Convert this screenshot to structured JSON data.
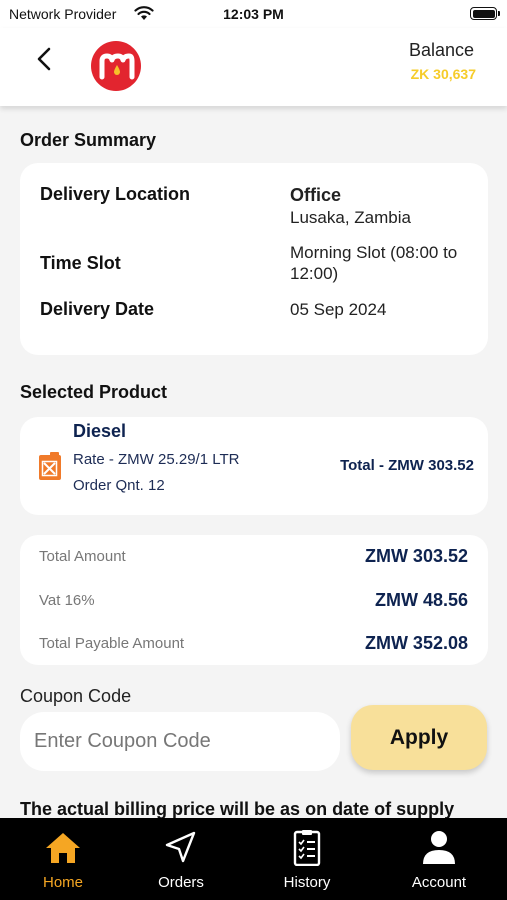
{
  "status_bar": {
    "carrier": "Network Provider",
    "time": "12:03 PM"
  },
  "header": {
    "balance_label": "Balance",
    "balance_value": "ZK 30,637",
    "logo_letter": "m",
    "brand_color": "#e2252f",
    "balance_color": "#f6cc2a"
  },
  "order_summary": {
    "title": "Order Summary",
    "delivery_location_label": "Delivery Location",
    "delivery_location_name": "Office",
    "delivery_location_city": "Lusaka, Zambia",
    "time_slot_label": "Time Slot",
    "time_slot_value": "Morning Slot (08:00 to 12:00)",
    "delivery_date_label": "Delivery Date",
    "delivery_date_value": "05 Sep 2024"
  },
  "selected_product": {
    "title": "Selected Product",
    "name": "Diesel",
    "rate": "Rate - ZMW 25.29/1 LTR",
    "quantity": "Order Qnt. 12",
    "total": "Total - ZMW 303.52",
    "icon": "fuel-can-icon"
  },
  "totals": {
    "total_amount_label": "Total Amount",
    "total_amount_value": "ZMW 303.52",
    "vat_label": "Vat 16%",
    "vat_value": "ZMW 48.56",
    "payable_label": "Total Payable Amount",
    "payable_value": "ZMW 352.08"
  },
  "coupon": {
    "label": "Coupon Code",
    "placeholder": "Enter Coupon Code",
    "value": "",
    "apply_label": "Apply"
  },
  "billing_note": "The actual billing price will be as on date of supply",
  "tabbar": {
    "tabs": [
      {
        "label": "Home",
        "icon": "home-icon",
        "active": true
      },
      {
        "label": "Orders",
        "icon": "navigation-arrow-icon",
        "active": false
      },
      {
        "label": "History",
        "icon": "clipboard-list-icon",
        "active": false
      },
      {
        "label": "Account",
        "icon": "person-icon",
        "active": false
      }
    ],
    "active_color": "#f5a623"
  }
}
